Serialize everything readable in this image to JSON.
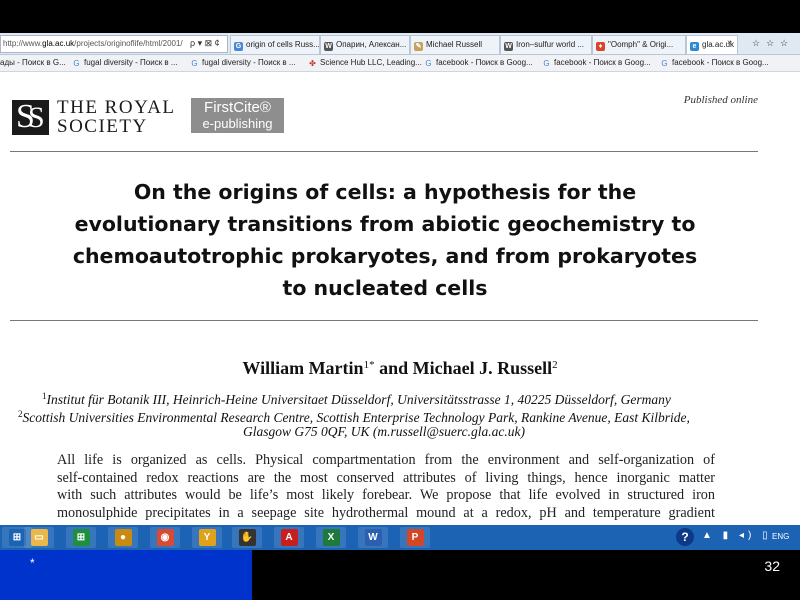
{
  "browser": {
    "address_prefix": "http://www.",
    "address_host": "gla.ac.uk",
    "address_path": "/projects/originoflife/html/2001/",
    "address_icons": "ρ ▾ ⊠ ¢",
    "tabs": [
      {
        "label": "origin of cells Russ...",
        "icon": "google",
        "color": "#4a85d6"
      },
      {
        "label": "Опарин, Алексан...",
        "icon": "wikipedia",
        "color": "#555555"
      },
      {
        "label": "Michael Russell",
        "icon": "site",
        "color": "#c7a25a"
      },
      {
        "label": "Iron–sulfur world ...",
        "icon": "wikipedia",
        "color": "#555555"
      },
      {
        "label": "\"Oomph\" & Origi...",
        "icon": "site",
        "color": "#d9442a"
      },
      {
        "label": "gla.ac.uk",
        "icon": "ie",
        "color": "#2a8ad4"
      }
    ],
    "tab_close": "×",
    "window_buttons": "☆☆☆",
    "favorites": [
      {
        "label": "ады - Поиск в G...",
        "icon": ""
      },
      {
        "label": "fugal diversity - Поиск в ...",
        "icon": "google"
      },
      {
        "label": "fugal diversity - Поиск в ...",
        "icon": "google"
      },
      {
        "label": "Science Hub LLC, Leading...",
        "icon": "sciencehub"
      },
      {
        "label": "facebook - Поиск в Goog...",
        "icon": "google"
      },
      {
        "label": "facebook - Поиск в Goog...",
        "icon": "google"
      },
      {
        "label": "facebook - Поиск в Goog...",
        "icon": "google"
      }
    ]
  },
  "document": {
    "publisher_line1": "THE ROYAL",
    "publisher_line2": "SOCIETY",
    "firstcite_line1": "FirstCite®",
    "firstcite_line2": "e-publishing",
    "published_online": "Published online",
    "title_lines": [
      "On the origins of cells: a hypothesis for the",
      "evolutionary transitions from abiotic geochemistry to",
      "chemoautotrophic prokaryotes, and from prokaryotes",
      "to nucleated cells"
    ],
    "author1": "William Martin",
    "author1_sup": "1*",
    "author_and": " and ",
    "author2": "Michael J. Russell",
    "author2_sup": "2",
    "affiliation1_num": "1",
    "affiliation1": "Institut für Botanik III, Heinrich-Heine Universitaet Düsseldorf, Universitätsstrasse 1, 40225 Düsseldorf, Germany",
    "affiliation2_num": "2",
    "affiliation2_line1": "Scottish Universities Environmental Research Centre, Scottish Enterprise Technology Park, Rankine Avenue, East Kilbride,",
    "affiliation2_line2": "Glasgow G75 0QF, UK (m.russell@suerc.gla.ac.uk)",
    "abstract_lines": [
      "All life is organized as cells. Physical compartmentation from the environment and self-organization of",
      "self-contained redox reactions are the most conserved attributes of living things, hence inorganic matter",
      "with such attributes would be life’s most likely forebear. We propose that life evolved in structured iron",
      "monosulphide precipitates in a seepage site hydrothermal mound at a redox, pH and temperature gradient"
    ]
  },
  "taskbar": {
    "items": [
      {
        "name": "start-icon",
        "glyph": "⊞",
        "bg": "#1c63b4"
      },
      {
        "name": "file-explorer-icon",
        "glyph": "▭",
        "bg": "#e8b84a"
      },
      {
        "name": "excel-icon",
        "glyph": "⊞",
        "bg": "#1e8f3f"
      },
      {
        "name": "media-icon",
        "glyph": "●",
        "bg": "#c98a12"
      },
      {
        "name": "chrome-icon",
        "glyph": "◉",
        "bg": "#d94a35"
      },
      {
        "name": "yandex-icon",
        "glyph": "Y",
        "bg": "#e0a21a"
      },
      {
        "name": "hand-icon",
        "glyph": "✋",
        "bg": "#333333"
      },
      {
        "name": "acrobat-icon",
        "glyph": "A",
        "bg": "#c81e1e"
      },
      {
        "name": "excel-file-icon",
        "glyph": "X",
        "bg": "#1e7a3a"
      },
      {
        "name": "word-icon",
        "glyph": "W",
        "bg": "#2b5faf"
      },
      {
        "name": "powerpoint-icon",
        "glyph": "P",
        "bg": "#d24726"
      }
    ],
    "help": "?",
    "tray_icons": "▲ ▮ ◂) ▯",
    "lang": "ENG"
  },
  "slide": {
    "marker": "*",
    "page_number": "32"
  }
}
